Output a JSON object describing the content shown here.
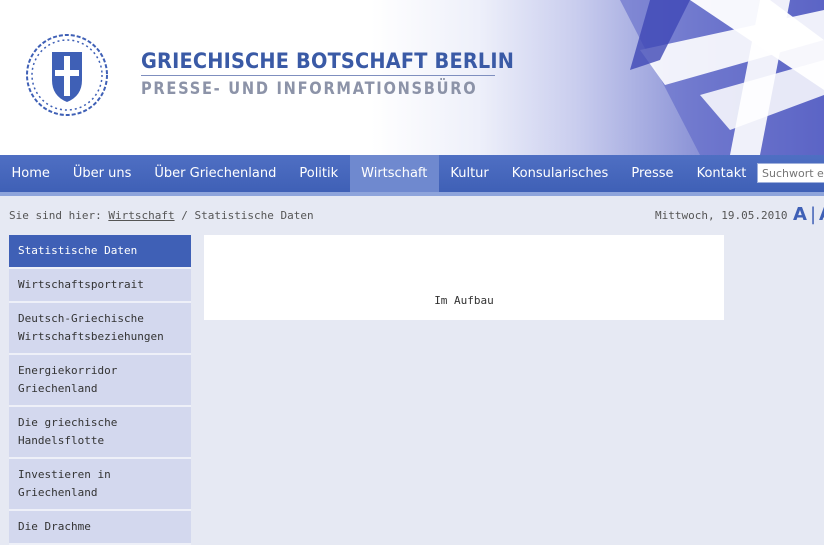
{
  "header": {
    "title": "GRIECHISCHE BOTSCHAFT BERLIN",
    "subtitle": "PRESSE- UND INFORMATIONSBÜRO",
    "emblem_icon": "greek-coat-of-arms-icon",
    "flag_icon": "greek-flag-icon"
  },
  "nav": {
    "items": [
      {
        "label": "Home"
      },
      {
        "label": "Über uns"
      },
      {
        "label": "Über Griechenland"
      },
      {
        "label": "Politik"
      },
      {
        "label": "Wirtschaft"
      },
      {
        "label": "Kultur"
      },
      {
        "label": "Konsularisches"
      },
      {
        "label": "Presse"
      },
      {
        "label": "Kontakt"
      }
    ],
    "active": "Wirtschaft",
    "search_placeholder": "Suchwort eingeben"
  },
  "breadcrumb": {
    "prefix": "Sie sind hier:",
    "link": "Wirtschaft",
    "separator": "/",
    "current": "Statistische Daten"
  },
  "date": "Mittwoch, 19.05.2010",
  "font_size_control": {
    "label": "A",
    "separator": "|",
    "label2": "A"
  },
  "sidebar": {
    "items": [
      {
        "label": "Statistische Daten"
      },
      {
        "label": "Wirtschaftsportrait"
      },
      {
        "label": "Deutsch-Griechische Wirtschaftsbeziehungen"
      },
      {
        "label": "Energiekorridor Griechenland"
      },
      {
        "label": "Die griechische Handelsflotte"
      },
      {
        "label": "Investieren in Griechenland"
      },
      {
        "label": "Die Drachme"
      }
    ],
    "active": "Statistische Daten"
  },
  "content": {
    "text": "Im Aufbau"
  },
  "colors": {
    "nav_bg": "#3f60b6",
    "nav_active": "#6f89cf",
    "title": "#3a5aa6",
    "subtitle": "#8c93a8",
    "sidebar_bg": "#d3d8ee",
    "page_bg": "#e6e9f3"
  }
}
